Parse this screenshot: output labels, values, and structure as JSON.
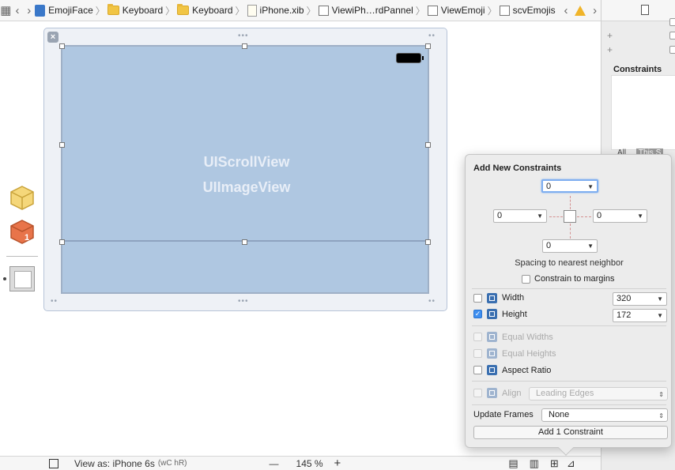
{
  "jumpbar": {
    "items": [
      "EmojiFace",
      "Keyboard",
      "Keyboard",
      "iPhone.xib",
      "ViewiPh…rdPannel",
      "ViewEmoji",
      "scvEmojis"
    ]
  },
  "inspector": {
    "constraints_title": "Constraints",
    "tab_all": "All",
    "tab_this": "This S"
  },
  "canvas": {
    "label_scroll": "UIScrollView",
    "label_image": "UIImageView"
  },
  "bottombar": {
    "view_as": "View as: iPhone 6s",
    "size_class": "(wC hR)",
    "minus": "—",
    "zoom": "145 %",
    "plus": "+"
  },
  "popover": {
    "title": "Add New Constraints",
    "top": "0",
    "left": "0",
    "right": "0",
    "bottom": "0",
    "spacing_hint": "Spacing to nearest neighbor",
    "constrain_margins": "Constrain to margins",
    "width_label": "Width",
    "width_value": "320",
    "height_label": "Height",
    "height_value": "172",
    "equal_widths": "Equal Widths",
    "equal_heights": "Equal Heights",
    "aspect_ratio": "Aspect Ratio",
    "align_label": "Align",
    "align_value": "Leading Edges",
    "update_frames_label": "Update Frames",
    "update_frames_value": "None",
    "add_button": "Add 1 Constraint"
  }
}
